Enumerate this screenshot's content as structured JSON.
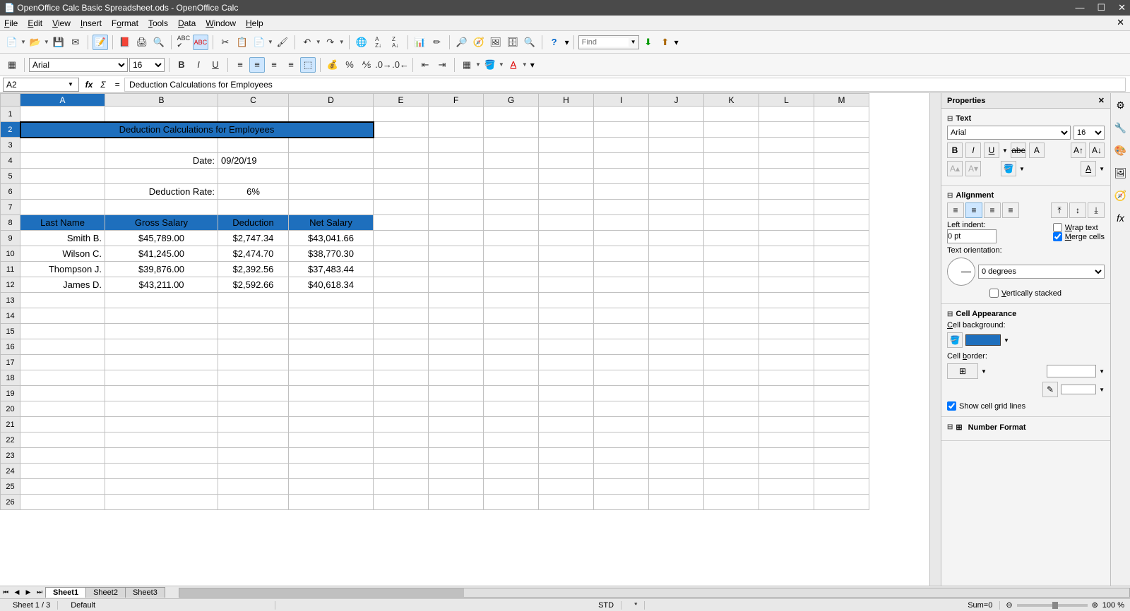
{
  "window": {
    "title": "OpenOffice Calc Basic Spreadsheet.ods - OpenOffice Calc"
  },
  "menu": [
    "File",
    "Edit",
    "View",
    "Insert",
    "Format",
    "Tools",
    "Data",
    "Window",
    "Help"
  ],
  "find_placeholder": "Find",
  "formula": {
    "cell_ref": "A2",
    "content": "Deduction Calculations for Employees"
  },
  "font": {
    "name": "Arial",
    "size": "16"
  },
  "columns": [
    "A",
    "B",
    "C",
    "D",
    "E",
    "F",
    "G",
    "H",
    "I",
    "J",
    "K",
    "L",
    "M"
  ],
  "sheet": {
    "title": "Deduction Calculations for Employees",
    "date_label": "Date:",
    "date": "09/20/19",
    "rate_label": "Deduction Rate:",
    "rate": "6%",
    "headers": [
      "Last Name",
      "Gross Salary",
      "Deduction",
      "Net Salary"
    ],
    "rows": [
      {
        "name": "Smith B.",
        "gross": "$45,789.00",
        "ded": "$2,747.34",
        "net": "$43,041.66"
      },
      {
        "name": "Wilson C.",
        "gross": "$41,245.00",
        "ded": "$2,474.70",
        "net": "$38,770.30"
      },
      {
        "name": "Thompson J.",
        "gross": "$39,876.00",
        "ded": "$2,392.56",
        "net": "$37,483.44"
      },
      {
        "name": "James D.",
        "gross": "$43,211.00",
        "ded": "$2,592.66",
        "net": "$40,618.34"
      }
    ]
  },
  "tabs": [
    "Sheet1",
    "Sheet2",
    "Sheet3"
  ],
  "properties": {
    "title": "Properties",
    "text": {
      "label": "Text",
      "font": "Arial",
      "size": "16"
    },
    "alignment": {
      "label": "Alignment",
      "indent_label": "Left indent:",
      "indent": "0 pt",
      "wrap": "Wrap text",
      "merge": "Merge cells",
      "orient_label": "Text orientation:",
      "orient": "0 degrees",
      "vstack": "Vertically stacked"
    },
    "appearance": {
      "label": "Cell Appearance",
      "bg_label": "Cell background:",
      "border_label": "Cell border:",
      "grid": "Show cell grid lines"
    },
    "numfmt": {
      "label": "Number Format"
    }
  },
  "status": {
    "sheet": "Sheet 1 / 3",
    "style": "Default",
    "mode": "STD",
    "star": "*",
    "sum": "Sum=0",
    "zoom": "100 %",
    "plus": "⊕",
    "minus": "⊖"
  }
}
